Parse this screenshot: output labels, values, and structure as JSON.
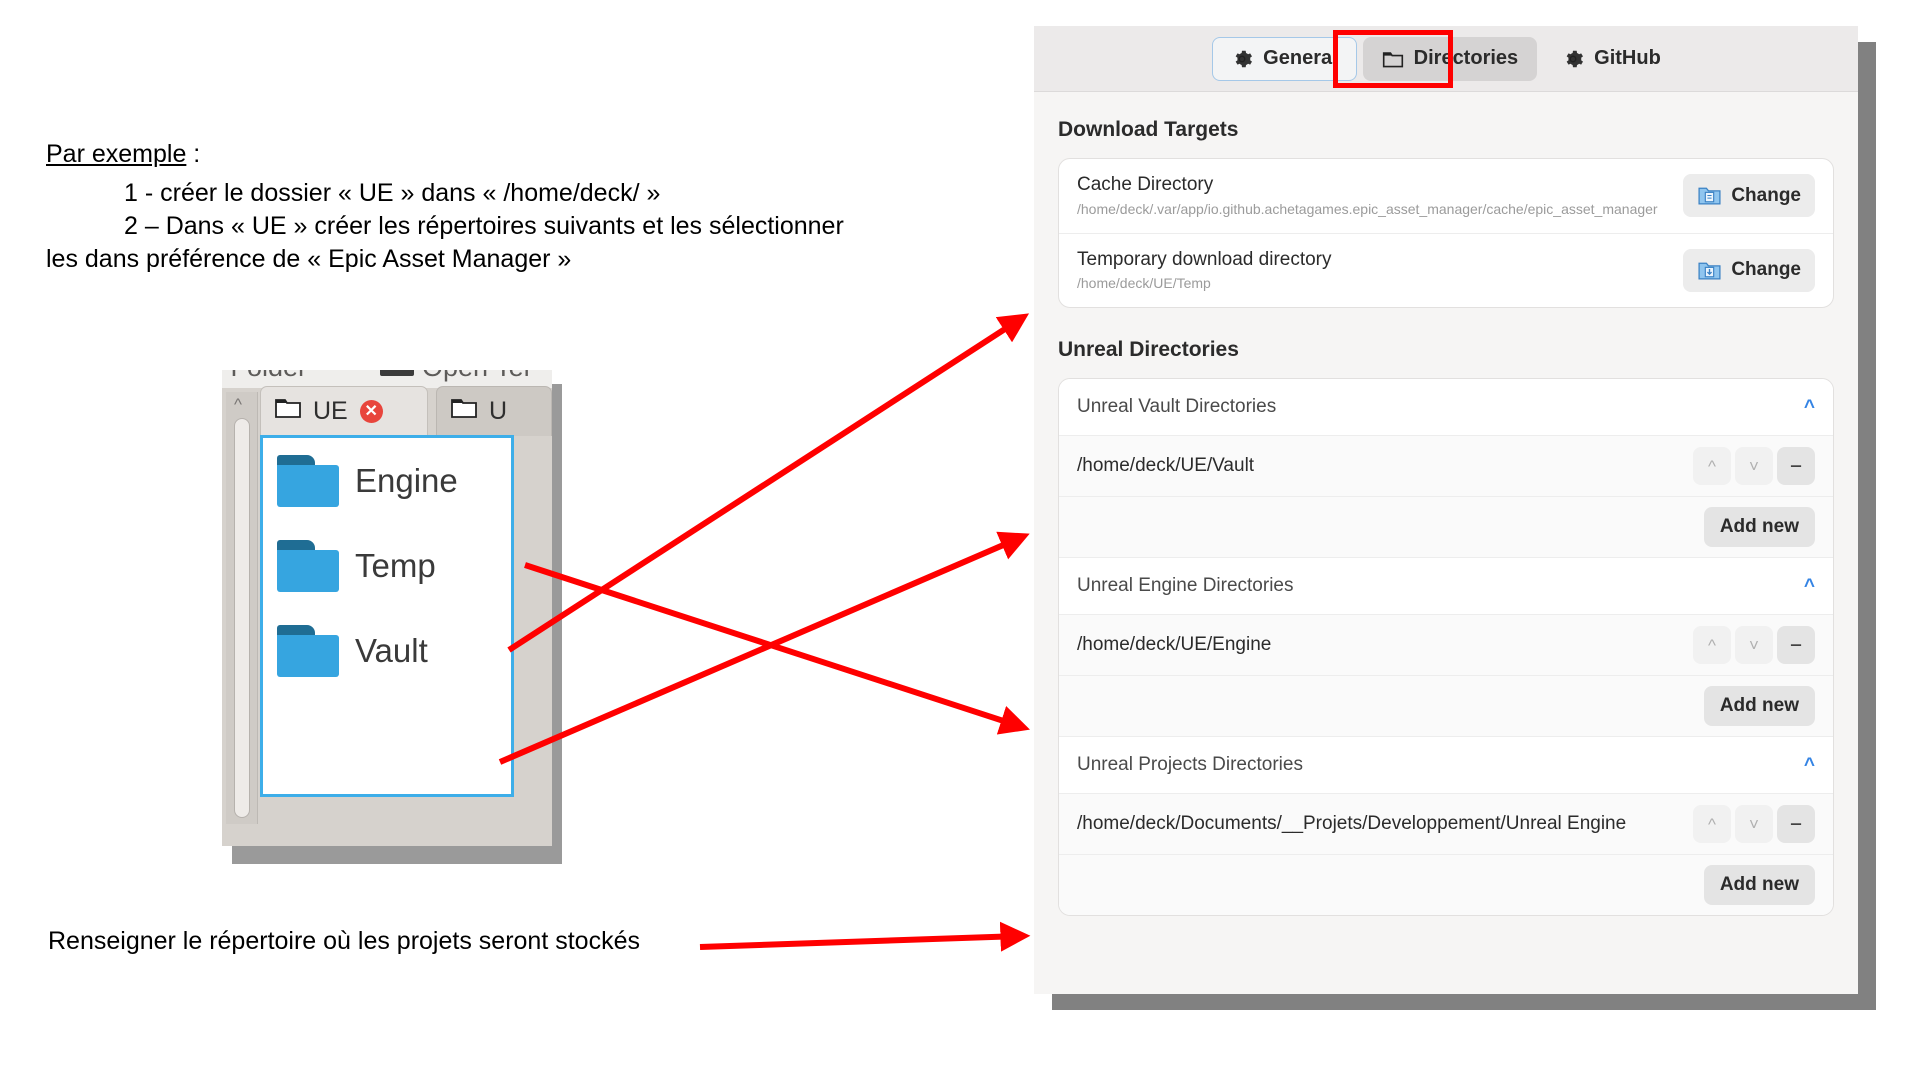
{
  "instructions": {
    "lead_underlined": "Par exemple",
    "lead_rest": " :",
    "step1": "1 - créer le dossier « UE » dans « /home/deck/ »",
    "step2": "2 – Dans « UE » créer les répertoires suivants et les sélectionner",
    "step2_cont": "les dans préférence de « Epic Asset Manager »"
  },
  "caption_bottom": "Renseigner le répertoire où les projets seront stockés",
  "file_manager": {
    "toolbar_left_clipped": "e Folder",
    "toolbar_right_clipped": "Open Ter",
    "tabs": [
      {
        "label": "UE",
        "icon": "folder-icon",
        "close_icon": "close-icon",
        "active": true
      },
      {
        "label": "U",
        "icon": "folder-icon",
        "active": false
      }
    ],
    "files": [
      {
        "name": "Engine",
        "icon": "folder-icon"
      },
      {
        "name": "Temp",
        "icon": "folder-icon"
      },
      {
        "name": "Vault",
        "icon": "folder-icon"
      }
    ],
    "scroll_up_icon": "chevron-up-icon"
  },
  "settings": {
    "tabs": [
      {
        "id": "general",
        "label": "General",
        "icon": "gear-icon",
        "state": "outlined"
      },
      {
        "id": "directories",
        "label": "Directories",
        "icon": "folder-icon",
        "state": "selected"
      },
      {
        "id": "github",
        "label": "GitHub",
        "icon": "gear-icon",
        "state": "normal"
      }
    ],
    "download_targets": {
      "title": "Download Targets",
      "rows": [
        {
          "title": "Cache Directory",
          "path": "/home/deck/.var/app/io.github.achetagames.epic_asset_manager/cache/epic_asset_manager",
          "button": "Change",
          "icon": "folder-document-icon"
        },
        {
          "title": "Temporary download directory",
          "path": "/home/deck/UE/Temp",
          "button": "Change",
          "icon": "folder-download-icon"
        }
      ]
    },
    "unreal_directories": {
      "title": "Unreal Directories",
      "add_new_label": "Add new",
      "collapse_icon": "chevron-up-icon",
      "move_up_icon": "chevron-up-icon",
      "move_down_icon": "chevron-down-icon",
      "remove_icon": "minus-icon",
      "groups": [
        {
          "label": "Unreal Vault Directories",
          "entries": [
            "/home/deck/UE/Vault"
          ]
        },
        {
          "label": "Unreal Engine Directories",
          "entries": [
            "/home/deck/UE/Engine"
          ]
        },
        {
          "label": "Unreal Projects Directories",
          "entries": [
            "/home/deck/Documents/__Projets/Developpement/Unreal Engine"
          ]
        }
      ]
    }
  },
  "annotation": {
    "color": "#ff0000",
    "highlight_target": "directories-tab"
  }
}
